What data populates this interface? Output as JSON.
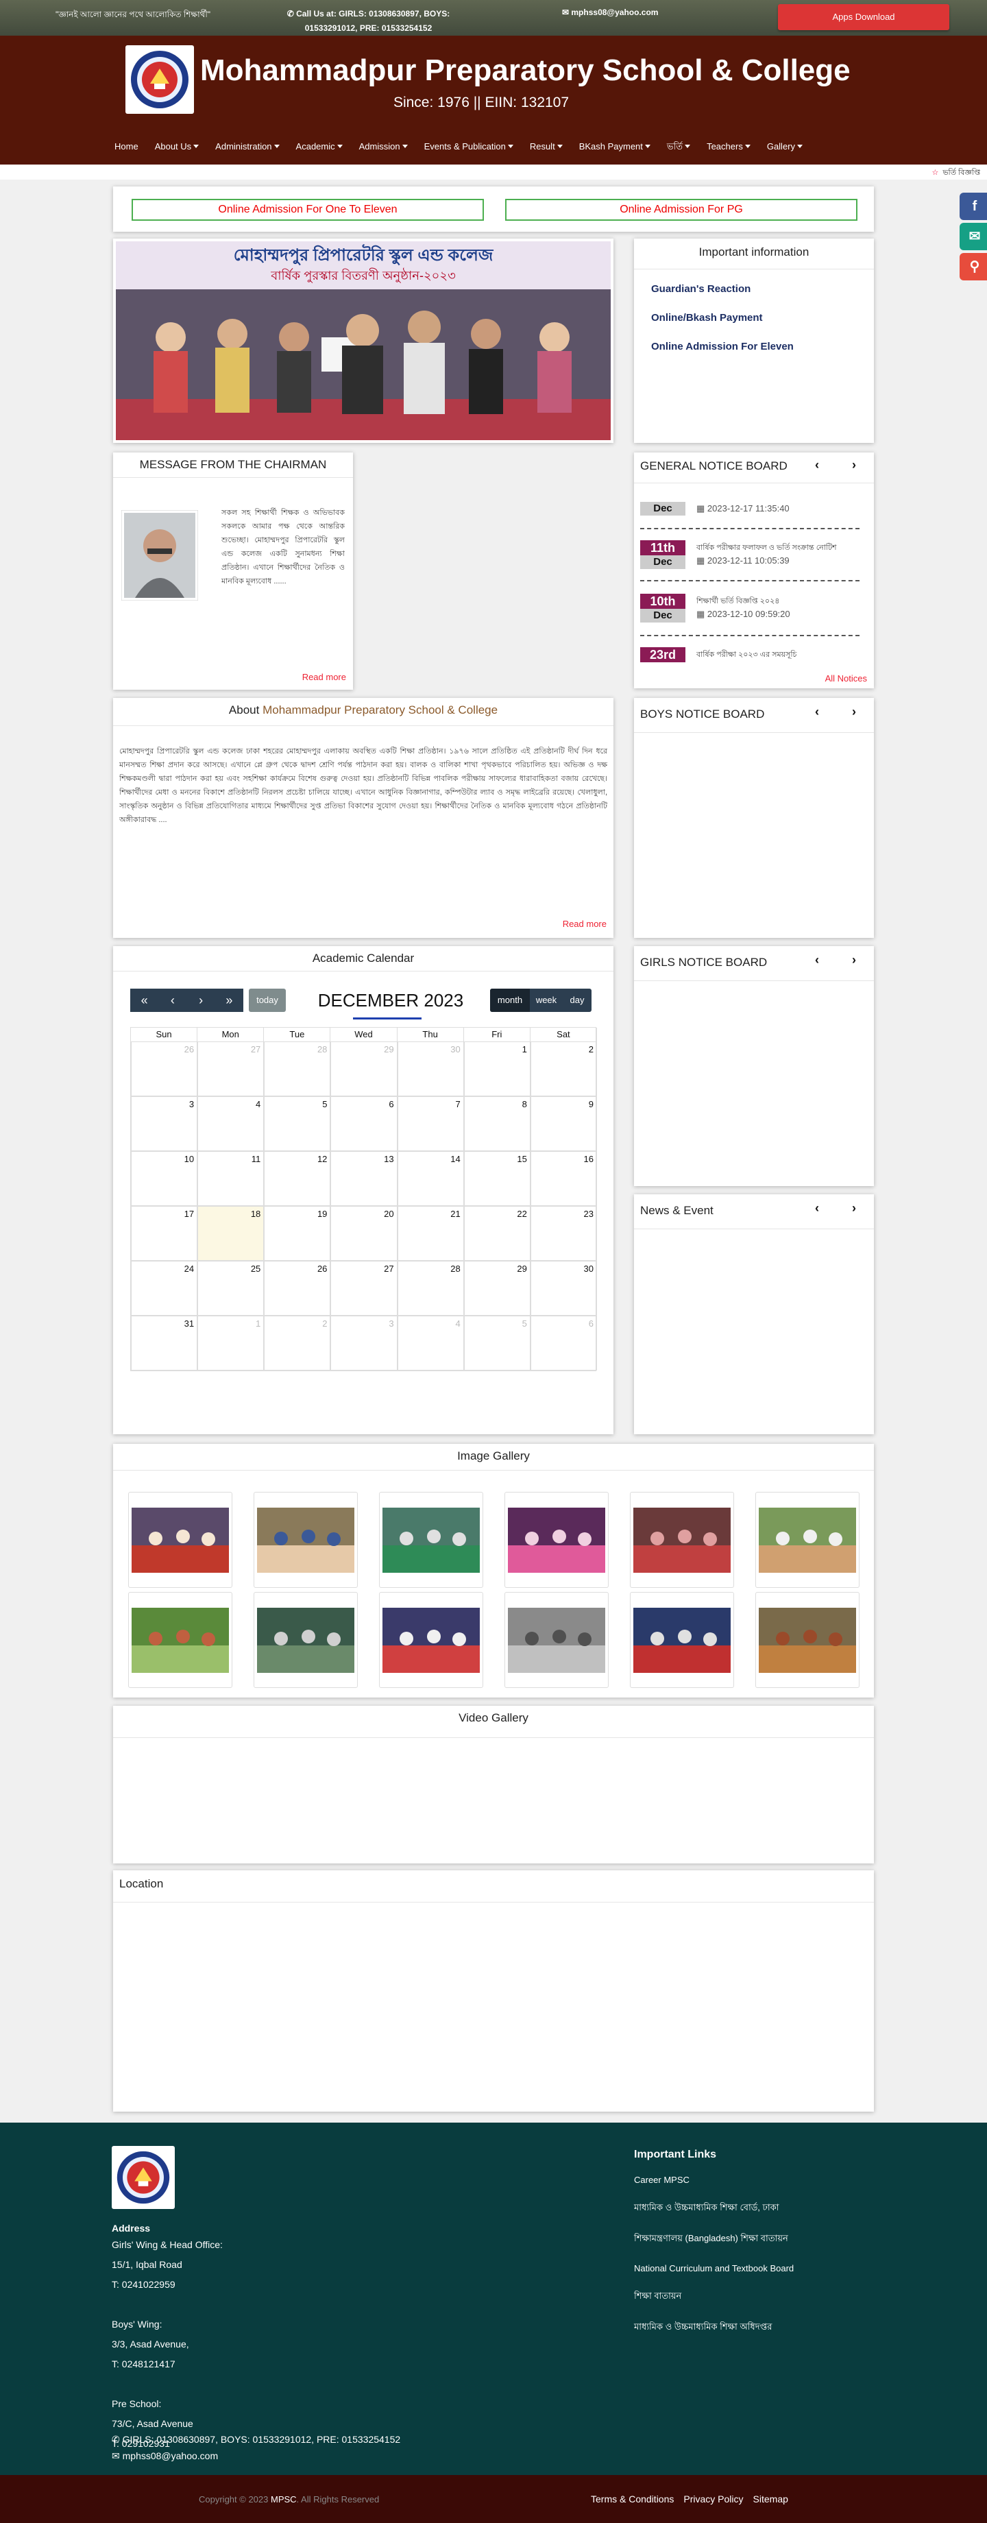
{
  "topbar": {
    "quote": "\"জ্ঞানই আলো জ্ঞানের পথে আলোকিত শিক্ষার্থী\"",
    "phone_line1": "Call Us at: GIRLS: 01308630897, BOYS:",
    "phone_line2": "01533291012, PRE: 01533254152",
    "email": "mphss08@yahoo.com",
    "apps_button": "Apps Download"
  },
  "header": {
    "school_name": "Mohammadpur Preparatory School & College",
    "since": "Since: 1976 || EIIN: 132107"
  },
  "nav": [
    {
      "label": "Home",
      "dropdown": false
    },
    {
      "label": "About Us",
      "dropdown": true
    },
    {
      "label": "Administration",
      "dropdown": true
    },
    {
      "label": "Academic",
      "dropdown": true
    },
    {
      "label": "Admission",
      "dropdown": true
    },
    {
      "label": "Events & Publication",
      "dropdown": true
    },
    {
      "label": "Result",
      "dropdown": true
    },
    {
      "label": "BKash Payment",
      "dropdown": true
    },
    {
      "label": "ভর্তি",
      "dropdown": true
    },
    {
      "label": "Teachers",
      "dropdown": true
    },
    {
      "label": "Gallery",
      "dropdown": true
    }
  ],
  "marquee": {
    "text": "ভর্তি বিজ্ঞপ্তি"
  },
  "social": [
    {
      "icon": "facebook-icon",
      "glyph": "f",
      "color": "#3b5998"
    },
    {
      "icon": "envelope-icon",
      "glyph": "✉",
      "color": "#16a085"
    },
    {
      "icon": "map-marker-icon",
      "glyph": "⚲",
      "color": "#e74c3c"
    }
  ],
  "admission": {
    "left": "Online Admission For One To Eleven",
    "right": "Online Admission For PG"
  },
  "banner": {
    "sign_title": "মোহাম্মদপুর প্রিপারেটরি স্কুল এন্ড কলেজ",
    "sign_subtitle": "বার্ষিক পুরস্কার বিতরণী অনুষ্ঠান-২০২৩"
  },
  "important": {
    "title": "Important information",
    "links": [
      "Guardian's Reaction",
      "Online/Bkash Payment",
      "Online Admission For Eleven"
    ]
  },
  "chairman": {
    "title": "MESSAGE FROM THE CHAIRMAN",
    "text": "সকল সহ শিক্ষার্থী শিক্ষক ও অভিভাবক সকলকে আমার পক্ষ থেকে আন্তরিক শুভেচ্ছা। মোহাম্মদপুর প্রিপারেটরি স্কুল এন্ড কলেজ একটি সুনামধন্য শিক্ষা প্রতিষ্ঠান। এখানে শিক্ষার্থীদের নৈতিক ও মানবিক মূল্যবোধ ......",
    "read_more": "Read more"
  },
  "general_notice": {
    "title": "GENERAL NOTICE BOARD",
    "items": [
      {
        "day": "",
        "month": "Dec",
        "text": "",
        "date": "2023-12-17 11:35:40"
      },
      {
        "day": "11th",
        "month": "Dec",
        "text": "বার্ষিক পরীক্ষার ফলাফল ও ভর্তি সংক্রান্ত নোটিশ",
        "date": "2023-12-11 10:05:39"
      },
      {
        "day": "10th",
        "month": "Dec",
        "text": "শিক্ষার্থী ভর্তি বিজ্ঞপ্তি ২০২৪",
        "date": "2023-12-10 09:59:20"
      },
      {
        "day": "23rd",
        "month": "",
        "text": "বার্ষিক পরীক্ষা ২০২৩ এর সময়সূচি",
        "date": ""
      }
    ],
    "all_notices": "All Notices"
  },
  "about": {
    "title_prefix": "About",
    "title_name": "Mohammadpur Preparatory School & College",
    "text": "মোহাম্মদপুর প্রিপারেটরি স্কুল এন্ড কলেজ ঢাকা শহরের মোহাম্মদপুর এলাকায় অবস্থিত একটি শিক্ষা প্রতিষ্ঠান। ১৯৭৬ সালে প্রতিষ্ঠিত এই প্রতিষ্ঠানটি দীর্ঘ দিন ধরে মানসম্মত শিক্ষা প্রদান করে আসছে। এখানে প্লে গ্রুপ থেকে দ্বাদশ শ্রেণি পর্যন্ত পাঠদান করা হয়। বালক ও বালিকা শাখা পৃথকভাবে পরিচালিত হয়। অভিজ্ঞ ও দক্ষ শিক্ষকমণ্ডলী দ্বারা পাঠদান করা হয় এবং সহশিক্ষা কার্যক্রমে বিশেষ গুরুত্ব দেওয়া হয়। প্রতিষ্ঠানটি বিভিন্ন পাবলিক পরীক্ষায় সাফল্যের ধারাবাহিকতা বজায় রেখেছে। শিক্ষার্থীদের মেধা ও মননের বিকাশে প্রতিষ্ঠানটি নিরলস প্রচেষ্টা চালিয়ে যাচ্ছে। এখানে আধুনিক বিজ্ঞানাগার, কম্পিউটার ল্যাব ও সমৃদ্ধ লাইব্রেরি রয়েছে। খেলাধুলা, সাংস্কৃতিক অনুষ্ঠান ও বিভিন্ন প্রতিযোগিতার মাধ্যমে শিক্ষার্থীদের সুপ্ত প্রতিভা বিকাশের সুযোগ দেওয়া হয়। শিক্ষার্থীদের নৈতিক ও মানবিক মূল্যবোধ গঠনে প্রতিষ্ঠানটি অঙ্গীকারাবদ্ধ ....",
    "read_more": "Read more"
  },
  "boys_notice": {
    "title": "BOYS NOTICE BOARD"
  },
  "girls_notice": {
    "title": "GIRLS NOTICE BOARD"
  },
  "news_event": {
    "title": "News & Event"
  },
  "calendar": {
    "title": "Academic Calendar",
    "month_label": "DECEMBER 2023",
    "today_button": "today",
    "views": [
      "month",
      "week",
      "day"
    ],
    "weekdays": [
      "Sun",
      "Mon",
      "Tue",
      "Wed",
      "Thu",
      "Fri",
      "Sat"
    ],
    "weeks": [
      [
        "26",
        "27",
        "28",
        "29",
        "30",
        "1",
        "2"
      ],
      [
        "3",
        "4",
        "5",
        "6",
        "7",
        "8",
        "9"
      ],
      [
        "10",
        "11",
        "12",
        "13",
        "14",
        "15",
        "16"
      ],
      [
        "17",
        "18",
        "19",
        "20",
        "21",
        "22",
        "23"
      ],
      [
        "24",
        "25",
        "26",
        "27",
        "28",
        "29",
        "30"
      ],
      [
        "31",
        "1",
        "2",
        "3",
        "4",
        "5",
        "6"
      ]
    ]
  },
  "gallery": {
    "title": "Image Gallery"
  },
  "video": {
    "title": "Video Gallery"
  },
  "location": {
    "title": "Location"
  },
  "footer": {
    "address_title": "Address",
    "address_lines": [
      "Girls' Wing & Head Office:",
      "15/1, Iqbal Road",
      "T: 0241022959",
      "",
      "Boys' Wing:",
      "3/3, Asad Avenue,",
      "T: 0248121417",
      "",
      "Pre School:",
      "73/C, Asad Avenue",
      "T: 029102931"
    ],
    "phone": "GIRLS: 01308630897, BOYS: 01533291012, PRE: 01533254152",
    "email": "mphss08@yahoo.com",
    "links_title": "Important Links",
    "links": [
      "Career MPSC",
      "মাধ্যমিক ও উচ্চমাধ্যমিক শিক্ষা বোর্ড, ঢাকা",
      "শিক্ষামন্ত্রণালয় (Bangladesh) শিক্ষা বাতায়ন",
      "National Curriculum and Textbook Board",
      "শিক্ষা বাতায়ন",
      "মাধ্যমিক ও উচ্চমাধ্যমিক শিক্ষা অধিদপ্তর"
    ],
    "copyright_prefix": "Copyright © 2023",
    "copyright_brand": "MPSC",
    "copyright_suffix": ". All Rights Reserved",
    "bottom_links": [
      "Terms & Conditions",
      "Privacy Policy",
      "Sitemap"
    ]
  }
}
